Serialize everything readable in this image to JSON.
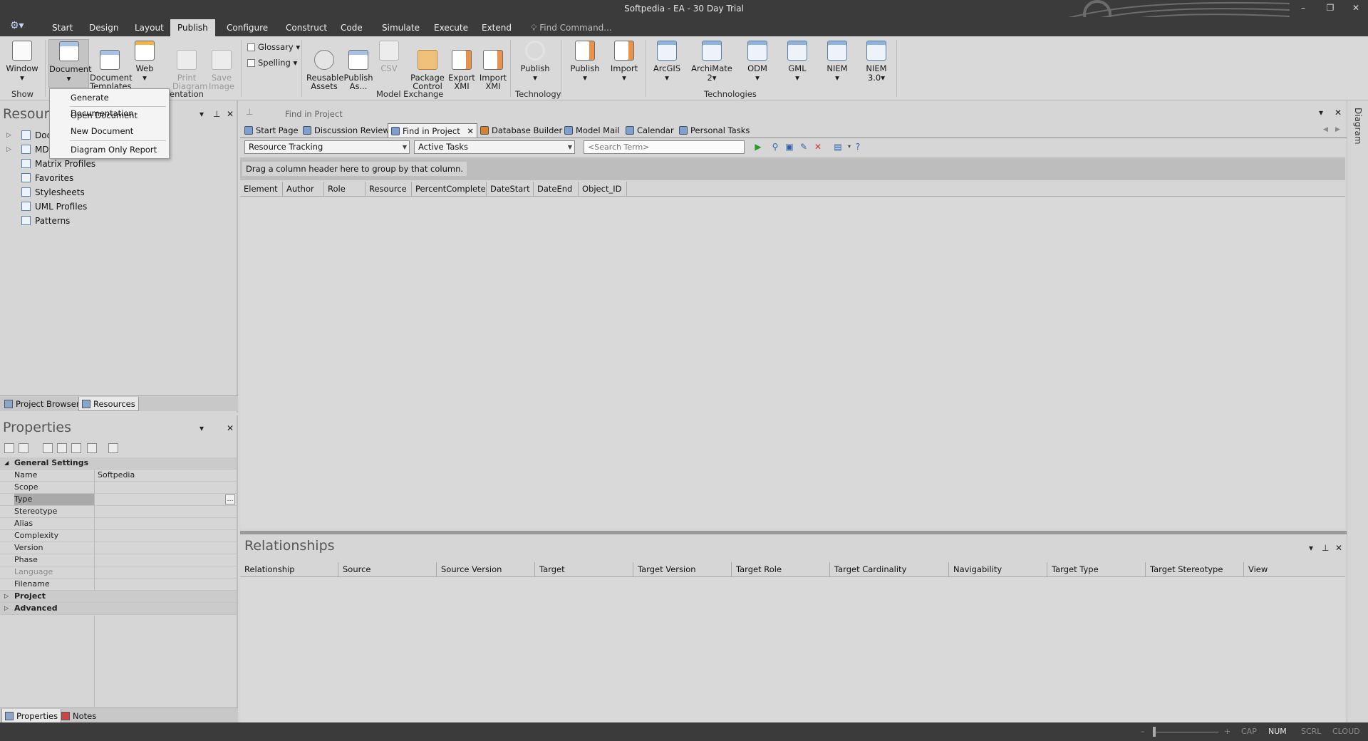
{
  "window": {
    "title": "Softpedia - EA - 30 Day Trial",
    "min": "–",
    "max": "❐",
    "close": "✕"
  },
  "menu": {
    "logo": "⚙▾",
    "tabs": [
      "Start",
      "Design",
      "Layout",
      "Publish",
      "Configure",
      "Construct",
      "Code",
      "Simulate",
      "Execute",
      "Extend"
    ],
    "active": "Publish",
    "find_command": "Find Command..."
  },
  "ribbon": {
    "show": {
      "window_label": "Window",
      "group": "Show"
    },
    "presentation": {
      "document": "Document",
      "document_templates": "Document\nTemplates",
      "web": "Web",
      "print_diagram": "Print\nDiagram",
      "save_image": "Save\nImage",
      "group": "entation"
    },
    "glossary": "Glossary",
    "spelling": "Spelling",
    "model_exchange": {
      "reusable_assets": "Reusable\nAssets",
      "publish_as": "Publish\nAs...",
      "csv": "CSV",
      "package_control": "Package\nControl",
      "export_xmi": "Export\nXMI",
      "import_xmi": "Import\nXMI",
      "group": "Model Exchange"
    },
    "technology": {
      "publish": "Publish",
      "group": "Technology"
    },
    "technologies": {
      "items": [
        "Publish",
        "Import",
        "ArcGIS",
        "ArchiMate\n2",
        "ODM",
        "GML",
        "NIEM",
        "NIEM\n3.0"
      ],
      "group": "Technologies"
    }
  },
  "document_menu": {
    "items": [
      "Generate Documentation",
      "Open Document",
      "New Document",
      "Diagram Only Report"
    ]
  },
  "resources": {
    "title": "Resources",
    "tree": [
      "Documents",
      "MDG Technologies",
      "Matrix Profiles",
      "Favorites",
      "Stylesheets",
      "UML Profiles",
      "Patterns"
    ],
    "bottom_tabs": [
      "Project Browser",
      "Resources"
    ],
    "active_tab": "Resources"
  },
  "properties": {
    "title": "Properties",
    "groups": {
      "general": "General Settings",
      "project": "Project",
      "advanced": "Advanced"
    },
    "rows": [
      {
        "key": "Name",
        "value": "Softpedia"
      },
      {
        "key": "Scope",
        "value": ""
      },
      {
        "key": "Type",
        "value": ""
      },
      {
        "key": "Stereotype",
        "value": ""
      },
      {
        "key": "Alias",
        "value": ""
      },
      {
        "key": "Complexity",
        "value": ""
      },
      {
        "key": "Version",
        "value": ""
      },
      {
        "key": "Phase",
        "value": ""
      },
      {
        "key": "Language",
        "value": ""
      },
      {
        "key": "Filename",
        "value": ""
      }
    ],
    "bottom_tabs": [
      "Properties",
      "Notes"
    ],
    "active_tab": "Properties"
  },
  "main": {
    "header": "Find in Project",
    "tabs": [
      "Start Page",
      "Discussion Review",
      "Find in Project",
      "Database Builder",
      "Model Mail",
      "Calendar",
      "Personal Tasks"
    ],
    "active_tab": "Find in Project",
    "search_category": "Resource Tracking",
    "search_query": "Active Tasks",
    "search_placeholder": "<Search Term>",
    "group_hint": "Drag a column header here to group by that column.",
    "columns": [
      "Element",
      "Author",
      "Role",
      "Resource",
      "PercentComplete",
      "DateStart",
      "DateEnd",
      "Object_ID"
    ]
  },
  "relationships": {
    "title": "Relationships",
    "columns": [
      "Relationship",
      "Source",
      "Source Version",
      "Target",
      "Target Version",
      "Target Role",
      "Target Cardinality",
      "Navigability",
      "Target Type",
      "Target Stereotype",
      "View"
    ]
  },
  "right_strip": {
    "label": "Diagram"
  },
  "status": {
    "zoom_minus": "–",
    "zoom_plus": "+",
    "cap": "CAP",
    "num": "NUM",
    "scrl": "SCRL",
    "cloud": "CLOUD"
  },
  "colors": {
    "chrome": "#3b3b3b",
    "ribbon": "#d9d9d9",
    "panel": "#d6d6d6",
    "accent": "#2a5fb0"
  }
}
